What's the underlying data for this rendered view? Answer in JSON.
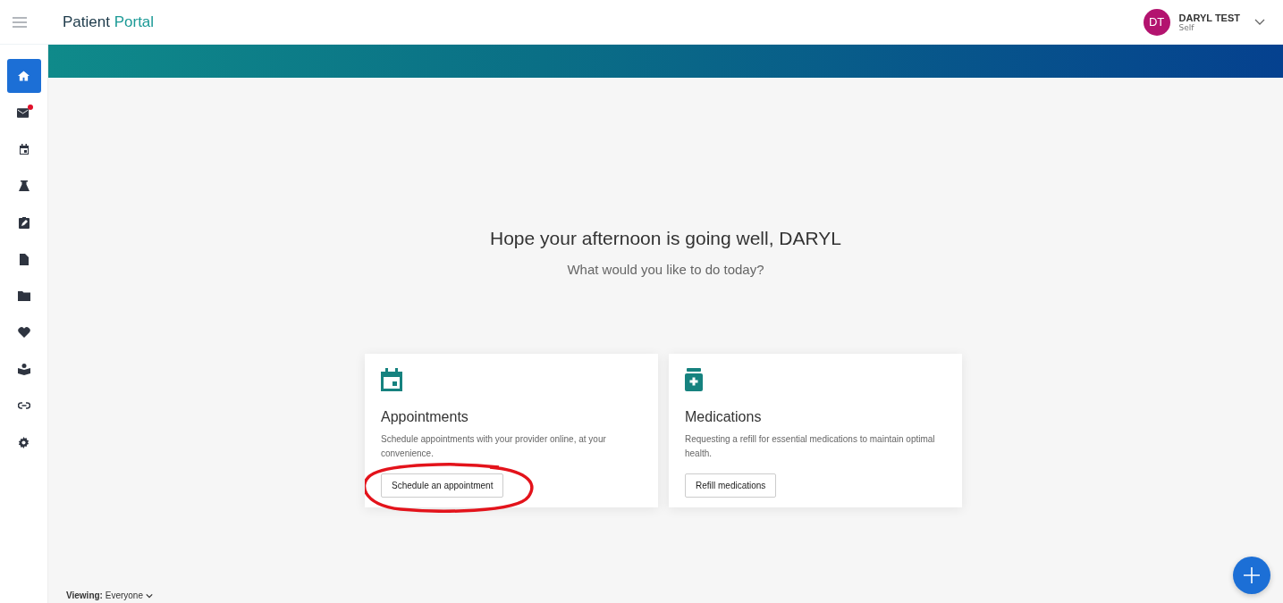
{
  "header": {
    "title_part_1": "Patient",
    "title_part_2": "Portal",
    "user": {
      "initials": "DT",
      "name": "DARYL TEST",
      "role": "Self"
    }
  },
  "sidebar": {
    "items": [
      {
        "kind": "home",
        "selected": true,
        "badge": false
      },
      {
        "kind": "mail",
        "selected": false,
        "badge": true
      },
      {
        "kind": "calendar",
        "selected": false,
        "badge": false
      },
      {
        "kind": "flask",
        "selected": false,
        "badge": false
      },
      {
        "kind": "clipboard",
        "selected": false,
        "badge": false
      },
      {
        "kind": "document",
        "selected": false,
        "badge": false
      },
      {
        "kind": "folder",
        "selected": false,
        "badge": false
      },
      {
        "kind": "heart",
        "selected": false,
        "badge": false
      },
      {
        "kind": "reader",
        "selected": false,
        "badge": false
      },
      {
        "kind": "link",
        "selected": false,
        "badge": false
      },
      {
        "kind": "settings",
        "selected": false,
        "badge": false
      }
    ]
  },
  "greeting": {
    "title": "Hope your afternoon is going well, DARYL",
    "subtitle": "What would you like to do today?"
  },
  "cards": [
    {
      "kind": "calendar",
      "title": "Appointments",
      "description": "Schedule appointments with your provider online, at your convenience.",
      "button": "Schedule an appointment",
      "circled": true
    },
    {
      "kind": "medication",
      "title": "Medications",
      "description": "Requesting a refill for essential medications to maintain optimal health.",
      "button": "Refill medications",
      "circled": false
    }
  ],
  "footer": {
    "label": "Viewing:",
    "value": "Everyone"
  }
}
